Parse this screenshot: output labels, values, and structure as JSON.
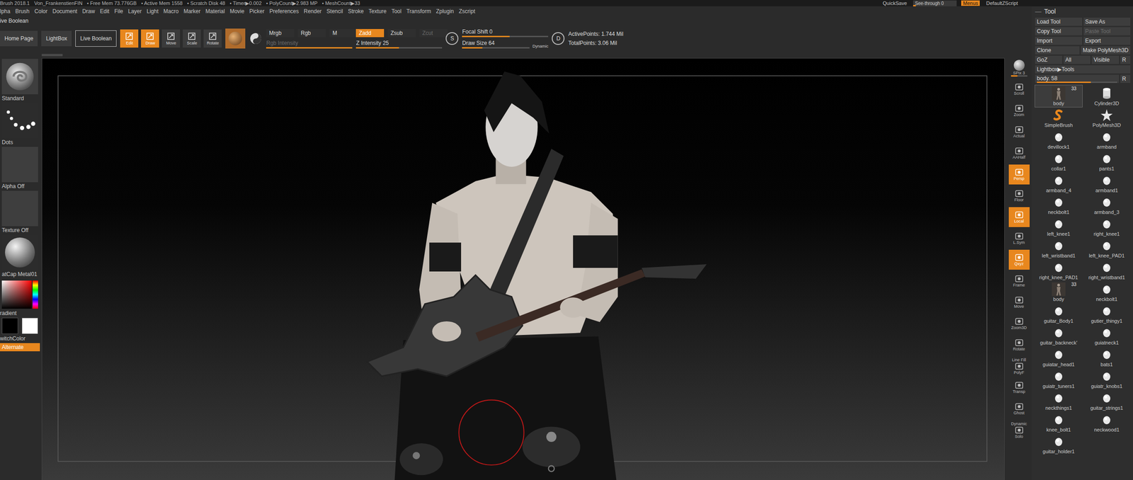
{
  "status_bar": {
    "items": [
      "Brush 2018.1",
      "Von_FrankenstienFIN",
      "• Free Mem 73.776GB",
      "• Active Mem 1558",
      "• Scratch Disk 48",
      "• Timer▶0.002",
      "• PolyCount▶2.983 MP",
      "• MeshCount▶33"
    ],
    "quicksave": "QuickSave",
    "see_through": {
      "label": "See-through  0",
      "level": 0.06
    },
    "menus": {
      "label": "Menus",
      "selected": true
    },
    "script": "DefaultZScript"
  },
  "menu": [
    "lpha",
    "Brush",
    "Color",
    "Document",
    "Draw",
    "Edit",
    "File",
    "Layer",
    "Light",
    "Macro",
    "Marker",
    "Material",
    "Movie",
    "Picker",
    "Preferences",
    "Render",
    "Stencil",
    "Stroke",
    "Texture",
    "Tool",
    "Transform",
    "Zplugin",
    "Zscript"
  ],
  "palette_title": "ive Boolean",
  "toolbar": {
    "nav": [
      {
        "label": "Home Page",
        "outlined": false
      },
      {
        "label": "LightBox",
        "outlined": false
      },
      {
        "label": "Live Boolean",
        "outlined": true
      }
    ],
    "transform": [
      {
        "label": "Edit",
        "selected": true
      },
      {
        "label": "Draw",
        "selected": true
      },
      {
        "label": "Move",
        "selected": false
      },
      {
        "label": "Scale",
        "selected": false
      },
      {
        "label": "Rotate",
        "selected": false
      }
    ],
    "color_modes": [
      {
        "label": "Mrgb",
        "selected": false
      },
      {
        "label": "Rgb",
        "selected": false
      },
      {
        "label": "M",
        "selected": false
      }
    ],
    "rgb_intensity": {
      "label": "Rgb Intensity",
      "level": 1,
      "disabled": true
    },
    "z_modes": [
      {
        "label": "Zadd",
        "selected": true,
        "disabled": false
      },
      {
        "label": "Zsub",
        "selected": false,
        "disabled": false
      },
      {
        "label": "Zcut",
        "selected": false,
        "disabled": true
      }
    ],
    "z_intensity": {
      "label": "Z Intensity 25",
      "level": 0.5
    },
    "focal_key": "S",
    "focal_shift": {
      "label": "Focal Shift 0",
      "level": 0.55
    },
    "draw_size": {
      "label": "Draw Size 64",
      "level": 0.3
    },
    "dynamic": "Dynamic",
    "draw_key": "D",
    "stats": [
      "ActivePoints: 1.744 Mil",
      "TotalPoints: 3.06 Mil"
    ]
  },
  "left_panel": {
    "items": [
      {
        "label": "Standard",
        "kind": "brush"
      },
      {
        "label": "Dots",
        "kind": "stroke"
      },
      {
        "label": "Alpha Off",
        "kind": "empty"
      },
      {
        "label": "Texture Off",
        "kind": "empty"
      },
      {
        "label": "atCap Metal01",
        "kind": "material"
      }
    ],
    "gradient": "radient",
    "swatches": [
      {
        "color": "#000000"
      },
      {
        "color": "#ffffff"
      }
    ],
    "switch_color": "witchColor",
    "alternate": {
      "label": "Alternate",
      "selected": true
    }
  },
  "shelf": [
    {
      "label": "SPix 3",
      "kind": "slider",
      "level": 0.4,
      "selected": false
    },
    {
      "label": "Scroll",
      "kind": "button",
      "selected": false
    },
    {
      "label": "Zoom",
      "kind": "button",
      "selected": false
    },
    {
      "label": "Actual",
      "kind": "button",
      "selected": false
    },
    {
      "label": "AAHalf",
      "kind": "button",
      "selected": false
    },
    {
      "label": "Persp",
      "kind": "button",
      "selected": true
    },
    {
      "label": "Floor",
      "kind": "button",
      "selected": false
    },
    {
      "label": "Local",
      "kind": "button",
      "selected": true
    },
    {
      "label": "L.Sym",
      "kind": "button",
      "selected": false
    },
    {
      "label": "Qxyz",
      "kind": "button",
      "selected": true
    },
    {
      "label": "Frame",
      "kind": "button",
      "selected": false
    },
    {
      "label": "Move",
      "kind": "button",
      "selected": false
    },
    {
      "label": "Zoom3D",
      "kind": "button",
      "selected": false
    },
    {
      "label": "Rotate",
      "kind": "button",
      "selected": false
    },
    {
      "label": "Line Fill",
      "sub": "PolyF",
      "kind": "button",
      "selected": false
    },
    {
      "label": "Transp",
      "kind": "button",
      "selected": false
    },
    {
      "label": "Ghost",
      "kind": "button",
      "selected": false
    },
    {
      "label": "Dynamic",
      "sub": "Solo",
      "kind": "button",
      "selected": false
    }
  ],
  "tool_panel": {
    "title": "Tool",
    "button_rows": [
      [
        {
          "label": "Load Tool",
          "disabled": false
        },
        {
          "label": "Save As",
          "disabled": false
        }
      ],
      [
        {
          "label": "Copy Tool",
          "disabled": false
        },
        {
          "label": "Paste Tool",
          "disabled": true
        }
      ],
      [
        {
          "label": "Import",
          "disabled": false
        },
        {
          "label": "Export",
          "disabled": false
        }
      ],
      [
        {
          "label": "Clone",
          "disabled": false
        },
        {
          "label": "Make PolyMesh3D",
          "disabled": false
        }
      ]
    ],
    "goz_row": [
      "GoZ",
      "All",
      "Visible",
      "R"
    ],
    "lightbox": "Lightbox▶Tools",
    "current": {
      "label": "body. 58",
      "level": 0.67,
      "reset": "R"
    },
    "subtools": [
      {
        "label": "body",
        "badge": "33",
        "kind": "figure",
        "selected": true
      },
      {
        "label": "Cylinder3D",
        "kind": "cylinder",
        "selected": false
      },
      {
        "label": "SimpleBrush",
        "kind": "brush",
        "selected": false
      },
      {
        "label": "PolyMesh3D",
        "kind": "star",
        "selected": false
      },
      {
        "label": "devillock1",
        "kind": "mesh",
        "selected": false
      },
      {
        "label": "armband",
        "kind": "mesh",
        "selected": false
      },
      {
        "label": "collar1",
        "kind": "mesh",
        "selected": false
      },
      {
        "label": "pants1",
        "kind": "mesh",
        "selected": false
      },
      {
        "label": "armband_4",
        "kind": "mesh",
        "selected": false
      },
      {
        "label": "armband1",
        "kind": "mesh",
        "selected": false
      },
      {
        "label": "neckbolt1",
        "kind": "mesh",
        "selected": false
      },
      {
        "label": "armband_3",
        "kind": "mesh",
        "selected": false
      },
      {
        "label": "left_knee1",
        "kind": "mesh",
        "selected": false
      },
      {
        "label": "right_knee1",
        "kind": "mesh",
        "selected": false
      },
      {
        "label": "left_wristband1",
        "kind": "mesh",
        "selected": false
      },
      {
        "label": "left_knee_PAD1",
        "kind": "mesh",
        "selected": false
      },
      {
        "label": "right_knee_PAD1",
        "kind": "mesh",
        "selected": false
      },
      {
        "label": "right_wristband1",
        "kind": "mesh",
        "selected": false
      },
      {
        "label": "body",
        "badge": "33",
        "kind": "figure",
        "selected": false
      },
      {
        "label": "neckbolt1",
        "kind": "mesh",
        "selected": false
      },
      {
        "label": "guitar_Body1",
        "kind": "mesh",
        "selected": false
      },
      {
        "label": "gutier_thingy1",
        "kind": "mesh",
        "selected": false
      },
      {
        "label": "guitar_backneck'",
        "kind": "mesh",
        "selected": false
      },
      {
        "label": "guiatneck1",
        "kind": "mesh",
        "selected": false
      },
      {
        "label": "guiatar_head1",
        "kind": "mesh",
        "selected": false
      },
      {
        "label": "bats1",
        "kind": "mesh",
        "selected": false
      },
      {
        "label": "guiatr_tuners1",
        "kind": "mesh",
        "selected": false
      },
      {
        "label": "guiatr_knobs1",
        "kind": "mesh",
        "selected": false
      },
      {
        "label": "neckthings1",
        "kind": "mesh",
        "selected": false
      },
      {
        "label": "guitar_strings1",
        "kind": "mesh",
        "selected": false
      },
      {
        "label": "knee_bolt1",
        "kind": "mesh",
        "selected": false
      },
      {
        "label": "neckwood1",
        "kind": "mesh",
        "selected": false
      },
      {
        "label": "guitar_holder1",
        "kind": "mesh",
        "selected": false
      }
    ]
  }
}
